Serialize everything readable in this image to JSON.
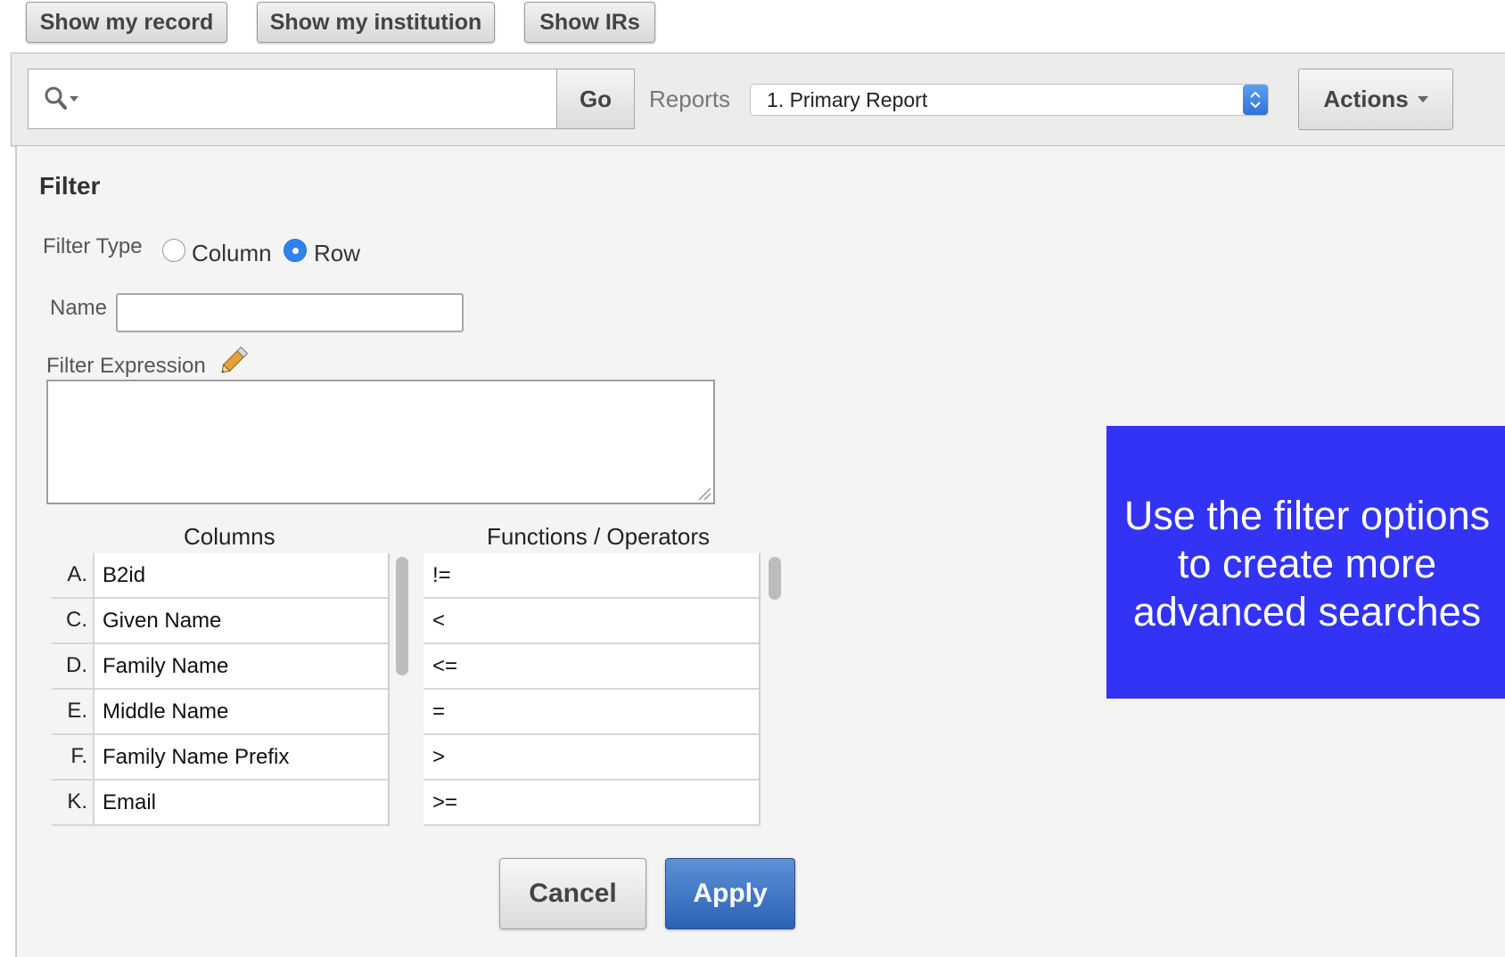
{
  "top_buttons": {
    "my_record": "Show my record",
    "my_institution": "Show my institution",
    "irs": "Show IRs"
  },
  "toolbar": {
    "search_value": "",
    "go_label": "Go",
    "reports_label": "Reports",
    "report_selected": "1. Primary Report",
    "actions_label": "Actions",
    "search_icon": "search-icon",
    "actions_icon": "caret-down-icon"
  },
  "filter": {
    "title": "Filter",
    "type_label": "Filter Type",
    "type_options": [
      "Column",
      "Row"
    ],
    "type_selected": "Row",
    "name_label": "Name",
    "name_value": "",
    "expression_label": "Filter Expression",
    "expression_value": "",
    "expression_icon": "pencil-eraser-icon",
    "columns_header": "Columns",
    "ops_header": "Functions / Operators",
    "columns": [
      {
        "letter": "A.",
        "name": "B2id"
      },
      {
        "letter": "C.",
        "name": "Given Name"
      },
      {
        "letter": "D.",
        "name": "Family Name"
      },
      {
        "letter": "E.",
        "name": "Middle Name"
      },
      {
        "letter": "F.",
        "name": "Family Name Prefix"
      },
      {
        "letter": "K.",
        "name": "Email"
      }
    ],
    "operators": [
      "!=",
      "<",
      "<=",
      "=",
      ">",
      ">="
    ],
    "cancel_label": "Cancel",
    "apply_label": "Apply"
  },
  "callout": {
    "lines": [
      "Use the filter options",
      "to create more",
      "advanced searches"
    ],
    "background": "#3333f5"
  },
  "colors": {
    "apply_blue": "#2c62b5",
    "radio_selected": "#2f82f0"
  }
}
